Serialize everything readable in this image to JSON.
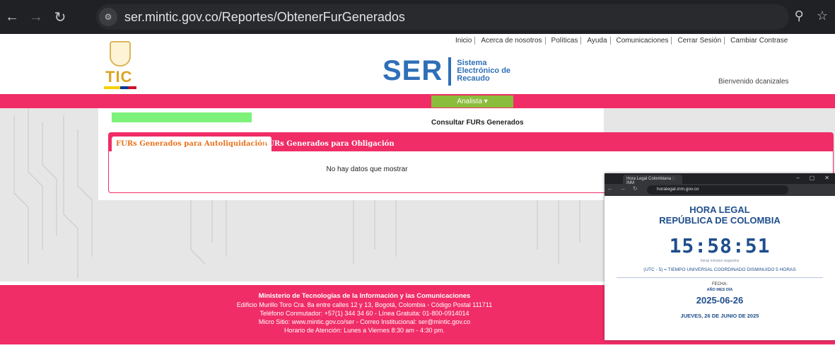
{
  "browser": {
    "url": "ser.mintic.gov.co/Reportes/ObtenerFurGenerados",
    "back_icon": "←",
    "forward_icon": "→",
    "reload_icon": "↻",
    "tune_icon": "⚙",
    "zoom_icon": "⚲",
    "star_icon": "☆"
  },
  "header": {
    "nav": [
      "Inicio",
      "Acerca de nosotros",
      "Políticas",
      "Ayuda",
      "Comunicaciones",
      "Cerrar Sesión",
      "Cambiar Contrase"
    ],
    "logo_tic": "TIC",
    "ser_big": "SER",
    "ser_line1": "Sistema",
    "ser_line2": "Electrónico de",
    "ser_line3": "Recaudo",
    "welcome": "Bienvenido dcanizales"
  },
  "role": {
    "label": "Analista ▾"
  },
  "main": {
    "title": "Consultar FURs Generados",
    "tabs": [
      "FURs Generados para Autoliquidación",
      "FURs Generados para Obligación"
    ],
    "empty": "No hay datos que mostrar"
  },
  "footer": {
    "line1": "Ministerio de Tecnologías de la Información y las Comunicaciones",
    "line2": "Edificio Murillo Toro Cra. 8a entre calles 12 y 13, Bogotá, Colombia - Código Postal 111711",
    "line3": "Teléfono Conmutador: +57(1) 344 34 60 - Línea Gratuita: 01-800-0914014",
    "line4": "Micro Sitio: www.mintic.gov.co/ser - Correo Institucional: ser@mintic.gov.co",
    "line5": "Horario de Atención: Lunes a Viernes 8:30 am - 4:30 pm."
  },
  "popup": {
    "tab_title": "Hora Legal Colombiana :: INM",
    "url": "horalegal.inm.gov.co",
    "heading1": "HORA LEGAL",
    "heading2": "REPÚBLICA DE COLOMBIA",
    "time": "15:58:51",
    "units": "horas    minutos    segundos",
    "utc": "(UTC - 5) = TIEMPO UNIVERSAL COORDINADO DISMINUIDO 5 HORAS",
    "fecha_label": "FECHA:",
    "ymd": "AÑO    MES    DÍA",
    "date": "2025-06-26",
    "day": "JUEVES, 26 DE JUNIO DE 2025"
  }
}
